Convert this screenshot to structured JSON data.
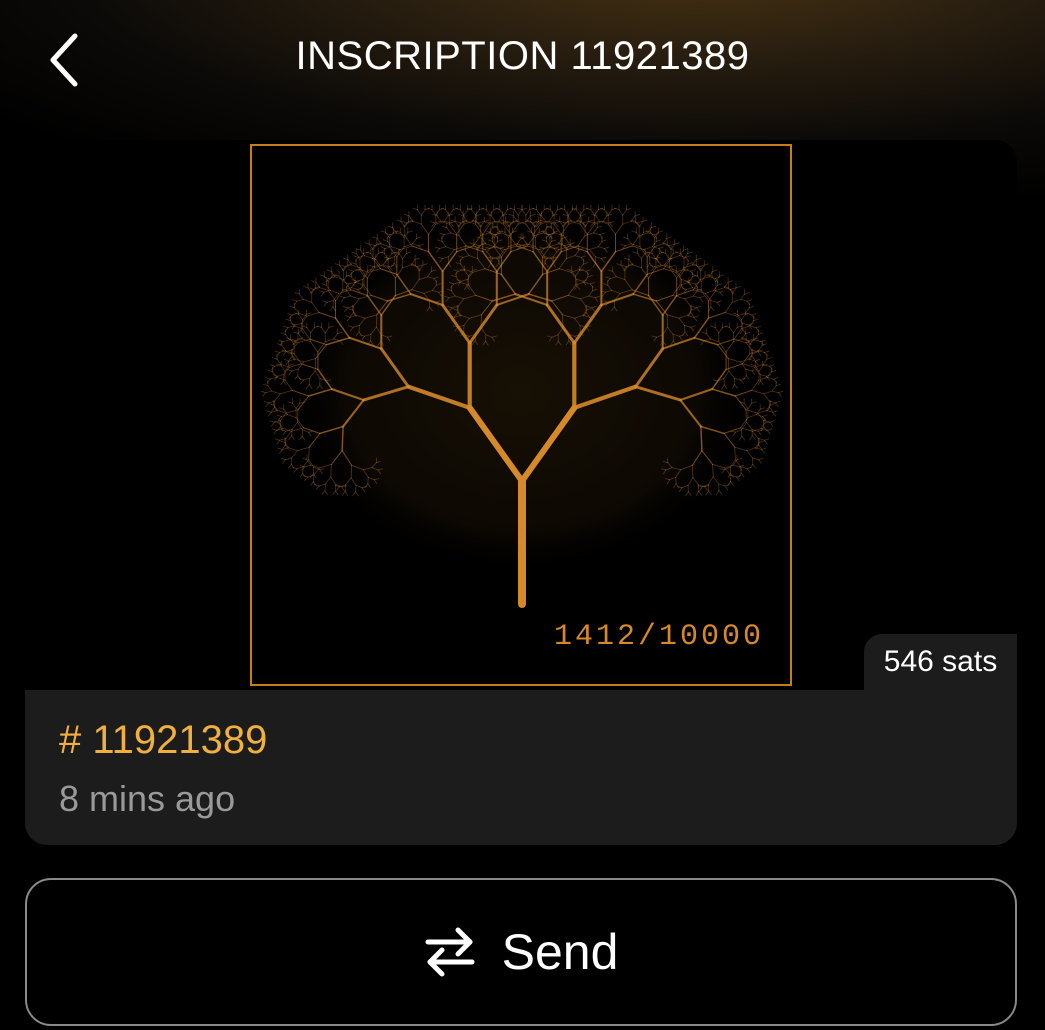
{
  "header": {
    "title": "INSCRIPTION 11921389",
    "back_icon": "chevron-left-icon"
  },
  "inscription": {
    "edition": "1412/10000",
    "price": "546 sats",
    "number": "# 11921389",
    "time_ago": "8 mins ago",
    "accent_color": "#f0b040",
    "art_color": "#d6892a"
  },
  "actions": {
    "send_label": "Send",
    "send_icon": "swap-arrows-icon"
  }
}
